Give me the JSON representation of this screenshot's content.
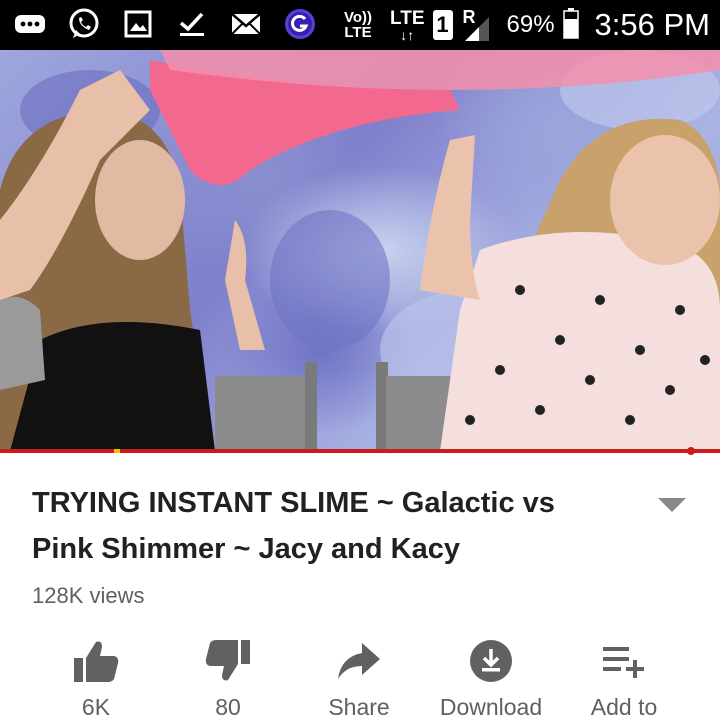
{
  "status_bar": {
    "volte": "Vo))",
    "volte_sub": "LTE",
    "lte": "LTE",
    "sim": "1",
    "roaming": "R",
    "battery_percent": "69%",
    "time": "3:56 PM",
    "icons": [
      "more-icon",
      "whatsapp-icon",
      "gallery-icon",
      "checkmark-icon",
      "mail-icon",
      "browser-icon",
      "battery-icon",
      "signal-icon"
    ]
  },
  "video": {
    "progress_percent": 96
  },
  "info": {
    "title": "TRYING INSTANT SLIME ~ Galactic vs Pink Shimmer ~ Jacy and Kacy",
    "views": "128K views"
  },
  "actions": [
    {
      "label": "6K",
      "icon": "thumbs-up-icon"
    },
    {
      "label": "80",
      "icon": "thumbs-down-icon"
    },
    {
      "label": "Share",
      "icon": "share-icon"
    },
    {
      "label": "Download",
      "icon": "download-icon"
    },
    {
      "label": "Add to",
      "icon": "add-to-playlist-icon"
    }
  ],
  "colors": {
    "accent": "#cc1b1b",
    "text_primary": "#212121",
    "text_secondary": "#606060"
  }
}
